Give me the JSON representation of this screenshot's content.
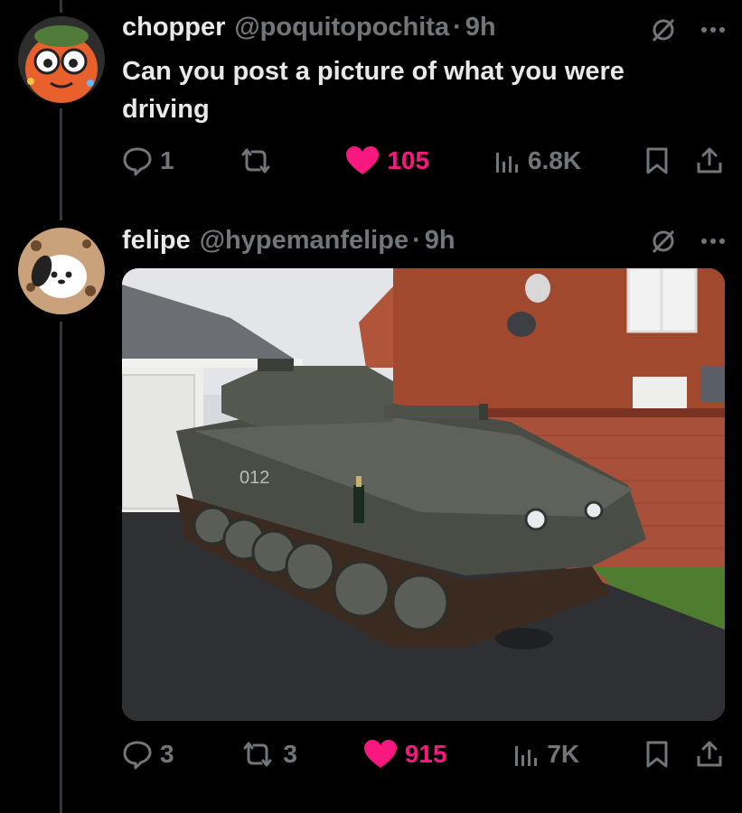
{
  "posts": [
    {
      "display_name": "chopper",
      "handle": "@poquitopochita",
      "separator": "·",
      "time": "9h",
      "text": "Can you post a picture of what you were driving",
      "replies": "1",
      "reposts": "",
      "likes": "105",
      "views": "6.8K"
    },
    {
      "display_name": "felipe",
      "handle": "@hypemanfelipe",
      "separator": "·",
      "time": "9h",
      "replies": "3",
      "reposts": "3",
      "likes": "915",
      "views": "7K",
      "photo_marking": "012"
    }
  ],
  "icons": {
    "reply": "speech-bubble-icon",
    "repost": "repost-arrows-icon",
    "like": "heart-filled-icon",
    "views": "bar-chart-icon",
    "bookmark": "bookmark-icon",
    "share": "share-upload-icon",
    "grok": "grok-slash-icon",
    "more": "more-dots-icon"
  },
  "colors": {
    "background": "#000000",
    "primary_text": "#e7e9ea",
    "secondary_text": "#71767b",
    "like_pink": "#f91880",
    "thread_line": "#333639"
  }
}
